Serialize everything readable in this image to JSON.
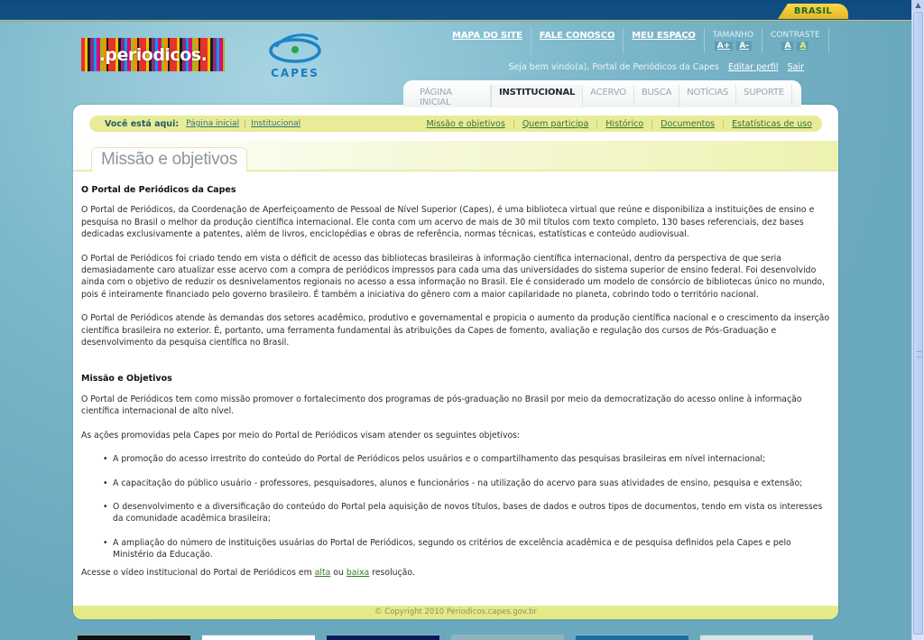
{
  "govbar": {
    "badge": "BRASIL"
  },
  "logos": {
    "periodicos": ".periodicos.",
    "capes": "CAPES"
  },
  "toplinks": {
    "items": [
      {
        "label": "MAPA DO SITE"
      },
      {
        "label": "FALE CONOSCO"
      },
      {
        "label": "MEU ESPAÇO"
      }
    ],
    "tamanho": {
      "label": "TAMANHO",
      "increase": "A+",
      "decrease": "A-"
    },
    "contraste": {
      "label": "CONTRASTE",
      "normal": "A",
      "high": "A"
    }
  },
  "welcome": {
    "text": "Seja bem vindo(a), Portal de Periódicos da Capes",
    "edit_profile": "Editar perfil",
    "logout": "Sair"
  },
  "tabs": [
    {
      "label": "PÁGINA INICIAL",
      "active": false
    },
    {
      "label": "INSTITUCIONAL",
      "active": true
    },
    {
      "label": "ACERVO",
      "active": false
    },
    {
      "label": "BUSCA",
      "active": false
    },
    {
      "label": "NOTÍCIAS",
      "active": false
    },
    {
      "label": "SUPORTE",
      "active": false
    }
  ],
  "breadcrumb": {
    "label": "Você está aqui:",
    "items": [
      "Página inicial",
      "Institucional"
    ],
    "separator": "|"
  },
  "subnav": [
    "Missão e objetivos",
    "Quem participa",
    "Histórico",
    "Documentos",
    "Estatísticas de uso"
  ],
  "page_title": "Missão e objetivos",
  "content": {
    "section1_title": "O Portal de Periódicos da Capes",
    "p1": "O Portal de Periódicos, da Coordenação de Aperfeiçoamento de Pessoal de Nível Superior (Capes), é uma biblioteca virtual que reúne e disponibiliza a instituições de ensino e pesquisa no Brasil o melhor da produção científica internacional. Ele conta com um acervo de mais de 30 mil títulos com texto completo, 130 bases referenciais, dez bases dedicadas exclusivamente a patentes, além de livros, enciclopédias e obras de referência, normas técnicas, estatísticas e conteúdo audiovisual.",
    "p2": "O Portal de Periódicos foi criado tendo em vista o déficit de acesso das bibliotecas brasileiras à informação científica internacional, dentro da perspectiva de que seria demasiadamente caro atualizar esse acervo com a compra de periódicos impressos para cada uma das universidades do sistema superior de ensino federal. Foi desenvolvido ainda com o objetivo de reduzir os desnivelamentos regionais no acesso a essa informação no Brasil. Ele é considerado um modelo de consórcio de bibliotecas único no mundo, pois é inteiramente financiado pelo governo brasileiro. É também a iniciativa do gênero com a maior capilaridade no planeta, cobrindo todo o território nacional.",
    "p3": "O Portal de Periódicos atende às demandas dos setores acadêmico, produtivo e governamental e propicia o aumento da produção científica nacional e o crescimento da inserção científica brasileira no exterior. É, portanto, uma ferramenta fundamental às atribuições da Capes de fomento, avaliação e regulação dos cursos de Pós-Graduação e desenvolvimento da pesquisa científica no Brasil.",
    "section2_title": "Missão e Objetivos",
    "p4": "O Portal de Periódicos tem como missão promover o fortalecimento dos programas de pós-graduação no Brasil por meio da democratização do acesso online à informação científica internacional de alto nível.",
    "p5": "As ações promovidas pela Capes por meio do Portal de Periódicos visam atender os seguintes objetivos:",
    "objectives": [
      "A promoção do acesso irrestrito do conteúdo do Portal de Periódicos pelos usuários e o compartilhamento das pesquisas brasileiras em nível internacional;",
      "A capacitação do público usuário - professores, pesquisadores, alunos e funcionários - na utilização do acervo para suas atividades de ensino, pesquisa e extensão;",
      "O desenvolvimento e a diversificação do conteúdo do Portal pela aquisição de novos títulos, bases de dados e outros tipos de documentos, tendo em vista os interesses da comunidade acadêmica brasileira;",
      "A ampliação do número de instituições usuárias do Portal de Periódicos, segundo os critérios de excelência acadêmica e de pesquisa definidos pela Capes e pelo Ministério da Educação."
    ],
    "video_prefix": "Acesse o vídeo institucional do Portal de Periódicos em",
    "video_high": "alta",
    "video_or": "ou",
    "video_low": "baixa",
    "video_suffix": "resolução."
  },
  "footer": {
    "copyright": "© Copyright 2010 Periodicos.capes.gov.br"
  },
  "colors": {
    "govbar": "#124f85",
    "background": "#6aa8bd",
    "crumbbar": "#e8ec96",
    "link_green": "#3b7a2a",
    "brasil_badge": "#f2cc3a"
  }
}
